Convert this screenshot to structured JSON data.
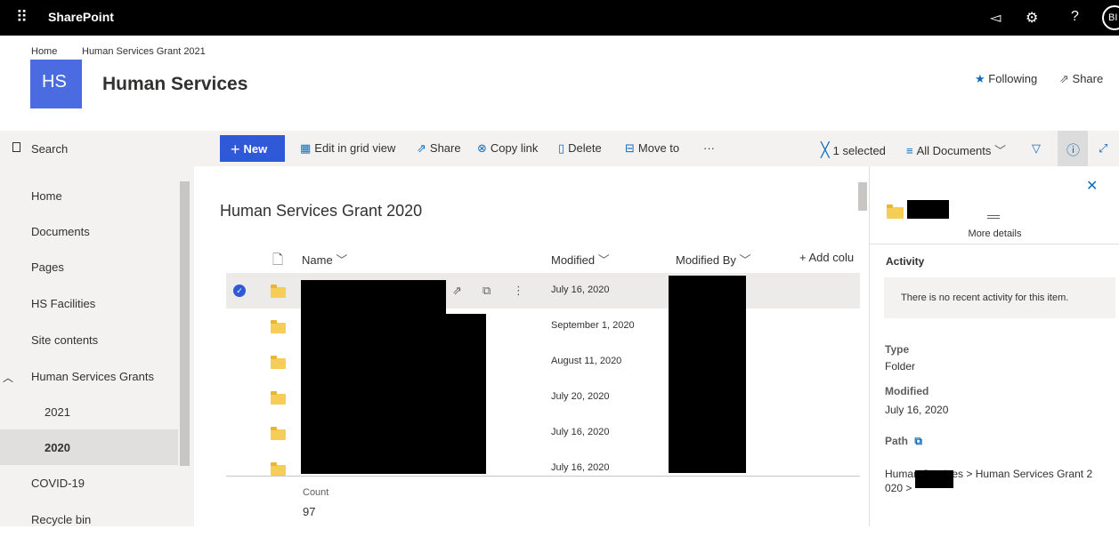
{
  "suite": {
    "app_name": "SharePoint",
    "waffle_icon": "waffle-icon",
    "icons": [
      "megaphone-icon",
      "gear-icon",
      "help-icon"
    ],
    "help_glyph": "?",
    "avatar_initials": "BI"
  },
  "breadcrumb": [
    "Home",
    "Human Services Grant 2021"
  ],
  "site": {
    "logo_text": "HS",
    "title": "Human Services",
    "following_label": "Following",
    "share_label": "Share"
  },
  "nav": {
    "search_label": "Search",
    "items": [
      "Home",
      "Documents",
      "Pages",
      "HS Facilities",
      "Site contents",
      "Human Services Grants",
      "2021",
      "2020",
      "COVID-19",
      "Recycle bin"
    ],
    "selected": "2020"
  },
  "commands": {
    "new": "New",
    "edit_grid": "Edit in grid view",
    "share": "Share",
    "copy_link": "Copy link",
    "delete": "Delete",
    "move_to": "Move to",
    "more": "···",
    "selected": "1 selected",
    "view": "All Documents"
  },
  "library": {
    "title": "Human Services Grant 2020",
    "columns": {
      "name": "Name",
      "modified": "Modified",
      "modified_by": "Modified By",
      "add": "+ Add colu"
    },
    "dates": [
      "July 16, 2020",
      "September 1, 2020",
      "August 11, 2020",
      "July 20, 2020",
      "July 16, 2020",
      "July 16, 2020"
    ],
    "count_label": "Count",
    "count_value": "97"
  },
  "details": {
    "more_details": "More details",
    "activity_title": "Activity",
    "activity_empty": "There is no recent activity for this item.",
    "type_label": "Type",
    "type_value": "Folder",
    "modified_label": "Modified",
    "modified_value": "July 16, 2020",
    "path_label": "Path",
    "path_part1": "Human Services",
    "path_part2": "Human Services Grant 2",
    "path_part3": "020",
    "path_sep": ">"
  },
  "colors": {
    "accent": "#0f6cbd",
    "new_button": "#2f59d6",
    "logo": "#4b6ce0",
    "folder": "#f6cd58"
  }
}
